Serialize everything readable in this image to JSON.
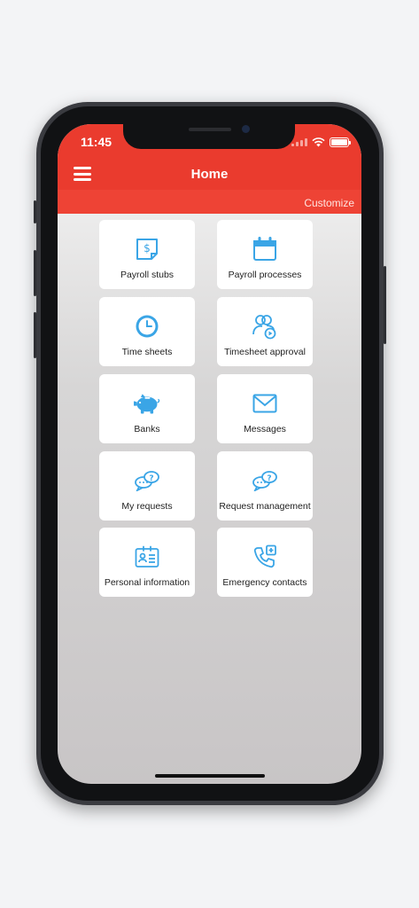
{
  "status_bar": {
    "time": "11:45"
  },
  "header": {
    "title": "Home",
    "customize_label": "Customize"
  },
  "colors": {
    "accent": "#ea3b2e",
    "icon": "#3aa5e6"
  },
  "tiles": [
    {
      "label": "Payroll stubs",
      "icon": "payroll-stub-icon"
    },
    {
      "label": "Payroll processes",
      "icon": "calendar-icon"
    },
    {
      "label": "Time sheets",
      "icon": "clock-icon"
    },
    {
      "label": "Timesheet approval",
      "icon": "user-approval-icon"
    },
    {
      "label": "Banks",
      "icon": "piggy-bank-icon"
    },
    {
      "label": "Messages",
      "icon": "envelope-icon"
    },
    {
      "label": "My requests",
      "icon": "chat-bubbles-icon"
    },
    {
      "label": "Request management",
      "icon": "chat-bubbles-icon"
    },
    {
      "label": "Personal information",
      "icon": "id-card-icon"
    },
    {
      "label": "Emergency contacts",
      "icon": "phone-plus-icon"
    }
  ]
}
